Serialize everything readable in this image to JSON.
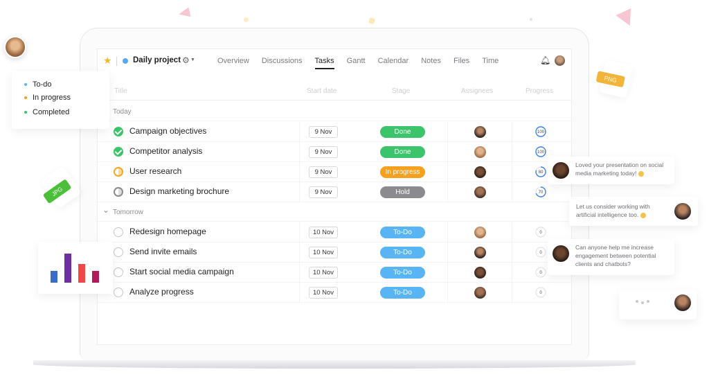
{
  "header": {
    "project_name": "Daily project",
    "project_color": "#58a8ef",
    "tabs": [
      {
        "label": "Overview",
        "active": false
      },
      {
        "label": "Discussions",
        "active": false
      },
      {
        "label": "Tasks",
        "active": true
      },
      {
        "label": "Gantt",
        "active": false
      },
      {
        "label": "Calendar",
        "active": false
      },
      {
        "label": "Notes",
        "active": false
      },
      {
        "label": "Files",
        "active": false
      },
      {
        "label": "Time",
        "active": false
      }
    ],
    "icons": {
      "star": "star-icon",
      "gear": "gear-icon",
      "bell": "bell-icon"
    }
  },
  "table": {
    "columns": {
      "title": "Title",
      "start_date": "Start date",
      "stage": "Stage",
      "assignees": "Assignees",
      "progress": "Progress"
    },
    "groups": [
      {
        "label": "Today",
        "tasks": [
          {
            "title": "Campaign objectives",
            "status": "done",
            "start_date": "9 Nov",
            "stage": "Done",
            "progress": 100
          },
          {
            "title": "Competitor analysis",
            "status": "done",
            "start_date": "9 Nov",
            "stage": "Done",
            "progress": 100
          },
          {
            "title": "User research",
            "status": "progress",
            "start_date": "9 Nov",
            "stage": "In progress",
            "progress": 80
          },
          {
            "title": "Design marketing brochure",
            "status": "hold",
            "start_date": "9 Nov",
            "stage": "Hold",
            "progress": 70
          }
        ]
      },
      {
        "label": "Tomorrow",
        "tasks": [
          {
            "title": "Redesign homepage",
            "status": "todo",
            "start_date": "10 Nov",
            "stage": "To-Do",
            "progress": 0
          },
          {
            "title": "Send invite emails",
            "status": "todo",
            "start_date": "10 Nov",
            "stage": "To-Do",
            "progress": 0
          },
          {
            "title": "Start social media campaign",
            "status": "todo",
            "start_date": "10 Nov",
            "stage": "To-Do",
            "progress": 0
          },
          {
            "title": "Analyze progress",
            "status": "todo",
            "start_date": "10 Nov",
            "stage": "To-Do",
            "progress": 0
          }
        ]
      }
    ]
  },
  "stage_colors": {
    "Done": "#3cc46b",
    "In progress": "#f5a01f",
    "Hold": "#8a8a8f",
    "To-Do": "#58b4f2"
  },
  "progress_color": "#3b82e8",
  "legend": {
    "items": [
      {
        "label": "To-do",
        "color": "#58b4f2"
      },
      {
        "label": "In progress",
        "color": "#f5a01f"
      },
      {
        "label": "Completed",
        "color": "#3cc46b"
      }
    ]
  },
  "files": {
    "jpg_label": "JPG",
    "png_label": "PNG"
  },
  "mini_chart": {
    "values": [
      2,
      5,
      3.2,
      2
    ],
    "colors": [
      "#3b6cc8",
      "#6e2fa0",
      "#f04848",
      "#b01a5a"
    ]
  },
  "chats": [
    {
      "text": "Loved your presentation on social media marketing today!",
      "emoji": true,
      "side": "left"
    },
    {
      "text": "Let us consider working with artificial intelligence too.",
      "emoji": true,
      "side": "right"
    },
    {
      "text": "Can anyone help me increase engagement between potential clients and chatbots?",
      "emoji": false,
      "side": "left"
    }
  ]
}
